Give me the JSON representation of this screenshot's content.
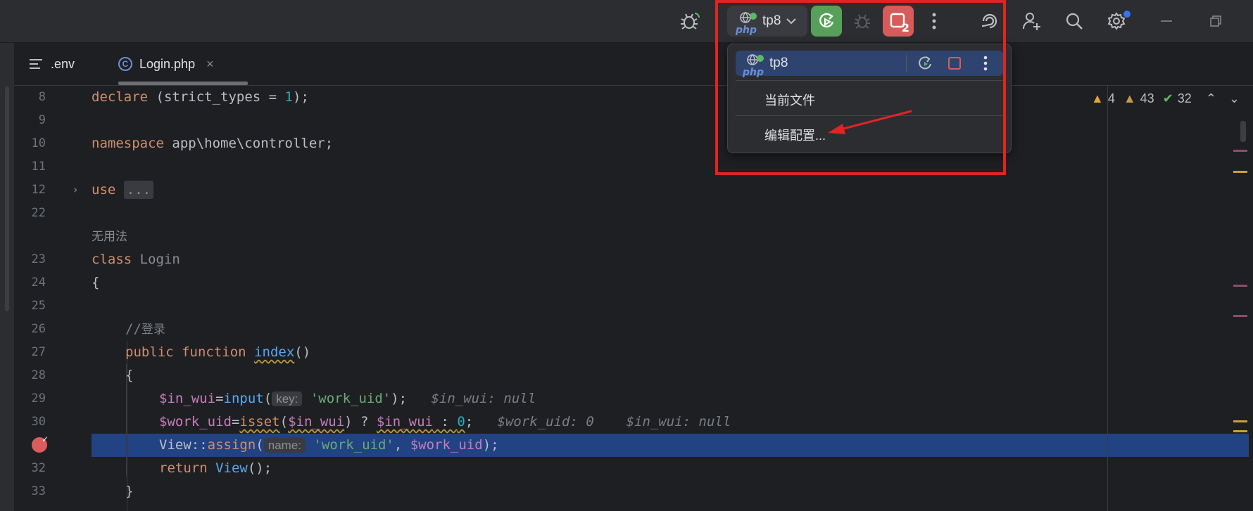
{
  "toolbar": {
    "run_config_name": "tp8",
    "stop_badge": "2"
  },
  "tabs": [
    {
      "label": ".env"
    },
    {
      "label": "Login.php",
      "close": "×"
    }
  ],
  "inspections": {
    "errors": "4",
    "warnings": "43",
    "ok": "32"
  },
  "popup": {
    "config_name": "tp8",
    "current_file": "当前文件",
    "edit_config": "编辑配置..."
  },
  "gutter": {
    "lines": [
      "8",
      "9",
      "10",
      "11",
      "12",
      "22",
      "23",
      "24",
      "25",
      "26",
      "27",
      "28",
      "29",
      "30",
      "32",
      "33"
    ]
  },
  "code": {
    "l8_kw": "declare",
    "l8_rest": " (strict_types = ",
    "l8_num": "1",
    "l8_end": ");",
    "l10_kw": "namespace",
    "l10_rest": " app\\home\\controller;",
    "l12_kw": "use",
    "l12_fold": "...",
    "unused_label": "无用法",
    "l23_kw": "class",
    "l23_name": "Login",
    "l24": "{",
    "l26_slashes": "//",
    "l26_cmt": "登录",
    "l27_kw1": "public",
    "l27_kw2": "function",
    "l27_fn": "index",
    "l27_end": "()",
    "l28": "{",
    "l29_var": "$in_wui",
    "l29_eq": "=",
    "l29_fn": "input",
    "l29_open": "(",
    "l29_hint": "key:",
    "l29_str": "'work_uid'",
    "l29_end": ");",
    "l29_val": "$in_wui: null",
    "l30_var": "$work_uid",
    "l30_eq": "=",
    "l30_fn": "isset",
    "l30_open": "(",
    "l30_var2": "$in_wui",
    "l30_mid": ") ? ",
    "l30_var3": "$in_wui",
    "l30_col": " : ",
    "l30_num": "0",
    "l30_end": ";",
    "l30_val1": "$work_uid: 0",
    "l30_val2": "$in_wui: null",
    "l31_cls": "View",
    "l31_sep": "::",
    "l31_fn": "assign",
    "l31_open": "(",
    "l31_hint": "name:",
    "l31_str": "'work_uid'",
    "l31_comma": ", ",
    "l31_var": "$work_uid",
    "l31_end": ");",
    "l32_kw": "return",
    "l32_fn": "View",
    "l32_end": "();",
    "l33": "}"
  },
  "colors": {
    "highlight": "#214283",
    "annotation_red": "#e02424",
    "rerun_green": "#56a05a",
    "stop_red": "#d65c5c"
  }
}
